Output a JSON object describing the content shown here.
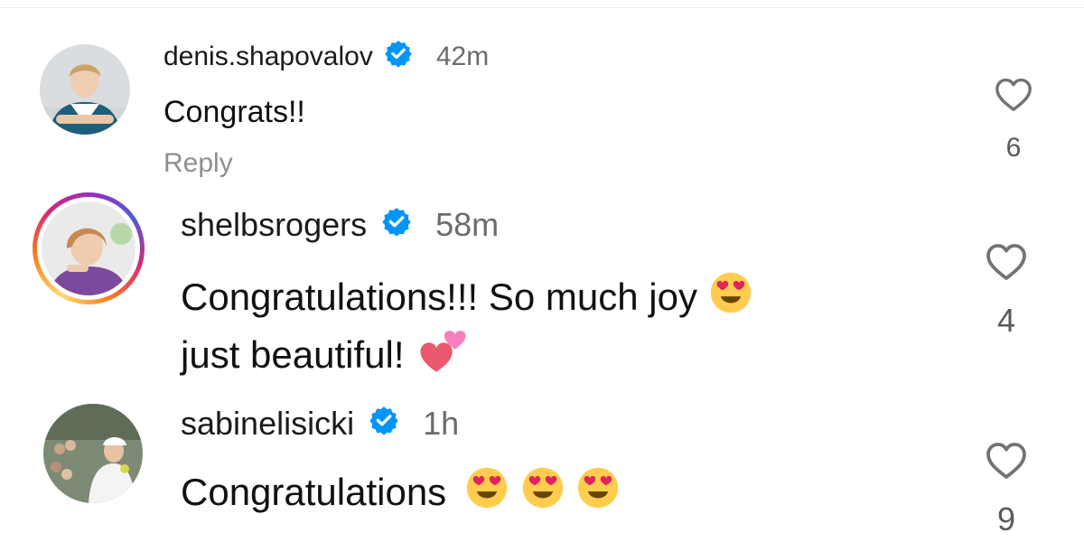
{
  "comments": [
    {
      "username": "denis.shapovalov",
      "verified": true,
      "time": "42m",
      "text": "Congrats!!",
      "reply_label": "Reply",
      "likes": "6",
      "avatar_icon": "profile-photo",
      "story_ring": false
    },
    {
      "username": "shelbsrogers",
      "verified": true,
      "time": "58m",
      "text_line1": "Congratulations!!! So much joy",
      "text_line1_emoji": "heart-eyes-emoji",
      "text_line2": "just beautiful!",
      "text_line2_emoji": "two-hearts-emoji",
      "likes": "4",
      "avatar_icon": "profile-photo",
      "story_ring": true
    },
    {
      "username": "sabinelisicki",
      "verified": true,
      "time": "1h",
      "text": "Congratulations",
      "emojis": [
        "heart-eyes-emoji",
        "heart-eyes-emoji",
        "heart-eyes-emoji"
      ],
      "likes": "9",
      "avatar_icon": "profile-photo",
      "story_ring": false
    }
  ],
  "colors": {
    "verified_badge": "#0095f6",
    "time_text": "#6b6b6b",
    "reply_text": "#8e8e8e",
    "like_icon": "#737373"
  }
}
